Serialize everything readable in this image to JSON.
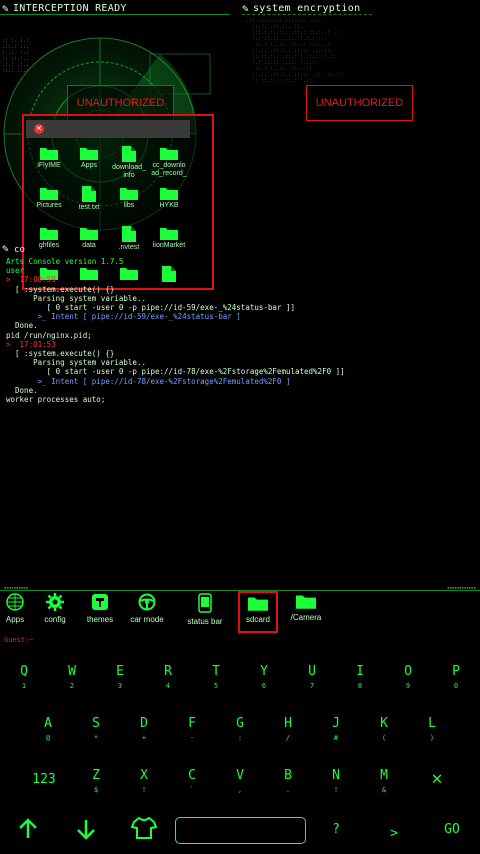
{
  "panels": {
    "interception_title": "INTERCEPTION READY",
    "encryption_title": "system encryption",
    "terminal_title": "co"
  },
  "unauthorized": {
    "left_label": "UNAUTHORIZED",
    "right_label": "UNAUTHORIZED"
  },
  "file_window": {
    "items": [
      {
        "label": "iFlyIME",
        "icon": "folder-icon"
      },
      {
        "label": "Apps",
        "icon": "folder-icon"
      },
      {
        "label": "download_\ninfo",
        "icon": "file-icon"
      },
      {
        "label": "cc_downlo\nad_record_",
        "icon": "folder-icon"
      },
      {
        "label": "Pictures",
        "icon": "folder-icon"
      },
      {
        "label": "test.txt",
        "icon": "file-icon"
      },
      {
        "label": "libs",
        "icon": "folder-icon"
      },
      {
        "label": "HYKB",
        "icon": "folder-icon"
      },
      {
        "label": "ghfiles",
        "icon": "folder-icon"
      },
      {
        "label": "data",
        "icon": "folder-icon"
      },
      {
        "label": ".nvtest",
        "icon": "file-icon"
      },
      {
        "label": "lionMarket",
        "icon": "folder-icon"
      },
      {
        "label": "",
        "icon": "folder-icon"
      },
      {
        "label": "",
        "icon": "folder-icon"
      },
      {
        "label": "",
        "icon": "folder-icon"
      },
      {
        "label": "",
        "icon": "file-icon"
      }
    ]
  },
  "terminal": {
    "lines": [
      {
        "text": "Arts Console version 1.7.5",
        "color": "g"
      },
      {
        "text": "user",
        "color": "g"
      },
      {
        "text": ">  17:00:59",
        "color": "r"
      },
      {
        "text": "  [ :system.execute() {}",
        "color": "w"
      },
      {
        "text": "      Parsing system variable..",
        "color": "w"
      },
      {
        "text": "         [ 0 start -user 0 -p pipe://id-59/exe-_%24status-bar ]]",
        "color": "w"
      },
      {
        "text": "       >_ Intent [ pipe://id-59/exe-_%24status-bar ]",
        "color": "b"
      },
      {
        "text": "  Done.",
        "color": "w"
      },
      {
        "text": "pid /run/nginx.pid;",
        "color": "w"
      },
      {
        "text": ">  17:01:53",
        "color": "r"
      },
      {
        "text": "  [ :system.execute() {}",
        "color": "w"
      },
      {
        "text": "      Parsing system variable..",
        "color": "w"
      },
      {
        "text": "         [ 0 start -user 0 -p pipe://id-78/exe-%2Fstorage%2Femulated%2F0 ]]",
        "color": "w"
      },
      {
        "text": "       >_ Intent [ pipe://id-78/exe-%2Fstorage%2Femulated%2F0 ]",
        "color": "b"
      },
      {
        "text": "  Done.",
        "color": "w"
      },
      {
        "text": "worker processes auto;",
        "color": "w"
      }
    ]
  },
  "dock": {
    "items": [
      {
        "label": "Apps",
        "icon": "grid-globe-icon"
      },
      {
        "label": "config",
        "icon": "gear-icon"
      },
      {
        "label": "themes",
        "icon": "paint-roller-icon"
      },
      {
        "label": "car mode",
        "icon": "steering-wheel-icon"
      },
      {
        "label": "status bar",
        "icon": "phone-icon"
      },
      {
        "label": "sdcard",
        "icon": "folder-icon",
        "highlighted": true
      },
      {
        "label": "/Camera",
        "icon": "folder-icon"
      }
    ]
  },
  "prompt": "Guest:~",
  "keyboard": {
    "row1": [
      {
        "k": "Q",
        "s": "1"
      },
      {
        "k": "W",
        "s": "2"
      },
      {
        "k": "E",
        "s": "3"
      },
      {
        "k": "R",
        "s": "4"
      },
      {
        "k": "T",
        "s": "5"
      },
      {
        "k": "Y",
        "s": "6"
      },
      {
        "k": "U",
        "s": "7"
      },
      {
        "k": "I",
        "s": "8"
      },
      {
        "k": "O",
        "s": "9"
      },
      {
        "k": "P",
        "s": "0"
      }
    ],
    "row2": [
      {
        "k": "A",
        "s": "@"
      },
      {
        "k": "S",
        "s": "*"
      },
      {
        "k": "D",
        "s": "+"
      },
      {
        "k": "F",
        "s": "-"
      },
      {
        "k": "G",
        "s": ":"
      },
      {
        "k": "H",
        "s": "/"
      },
      {
        "k": "J",
        "s": "#"
      },
      {
        "k": "K",
        "s": "("
      },
      {
        "k": "L",
        "s": ")"
      }
    ],
    "row3": [
      {
        "k": "Z",
        "s": "$"
      },
      {
        "k": "X",
        "s": "!"
      },
      {
        "k": "C",
        "s": "`"
      },
      {
        "k": "V",
        "s": ","
      },
      {
        "k": "B",
        "s": "."
      },
      {
        "k": "N",
        "s": "!"
      },
      {
        "k": "M",
        "s": "&"
      }
    ],
    "num_label": "123",
    "question": "?",
    "greater": ">",
    "go": "GO"
  }
}
